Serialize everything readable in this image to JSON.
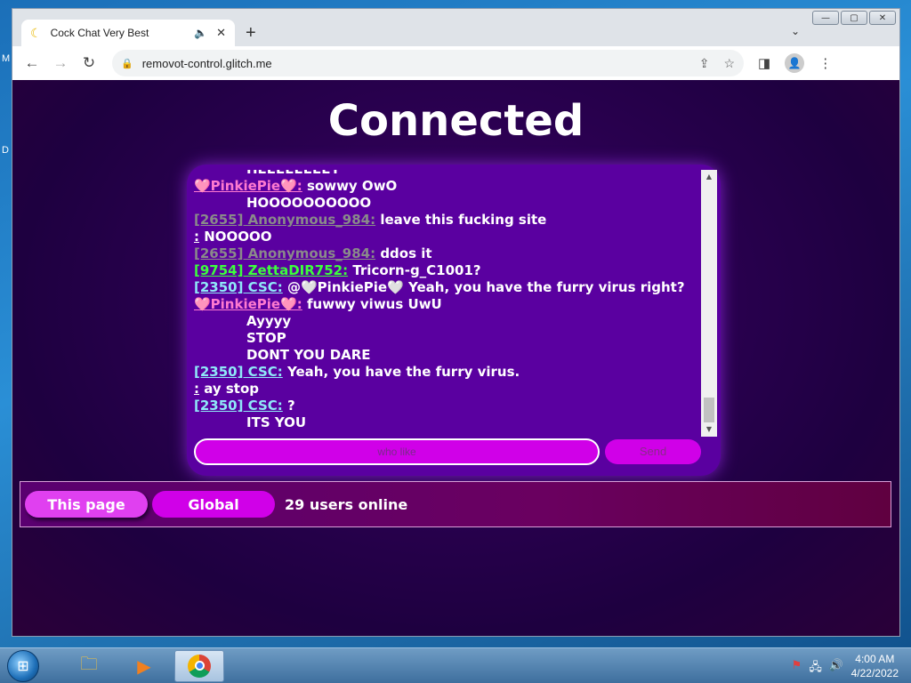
{
  "desktop": {
    "edge_glyph_1": "M",
    "edge_glyph_2": "D"
  },
  "window": {
    "minimize": "—",
    "maximize": "▢",
    "close": "✕"
  },
  "tab": {
    "title": "Cock Chat Very Best",
    "favicon": "☾",
    "mute_icon": "🔈",
    "close": "✕"
  },
  "newtab": "+",
  "tab_dropdown": "⌄",
  "toolbar": {
    "back": "←",
    "forward": "→",
    "reload": "↻",
    "lock": "🔒",
    "url": "removot-control.glitch.me",
    "share": "⇪",
    "star": "☆",
    "sidepanel": "◨",
    "profile": "👤",
    "menu": "⋮"
  },
  "page": {
    "title": "Connected",
    "messages": [
      {
        "indent": true,
        "cut": true,
        "user": "",
        "text": "HEEEEEEEEY"
      },
      {
        "user": "🩷PinkiePie🩷:",
        "color": "pink",
        "text": " sowwy OwO"
      },
      {
        "indent": true,
        "user": "",
        "text": "HOOOOOOOOOO"
      },
      {
        "user": "[2655] Anonymous_984:",
        "color": "gray",
        "text": " leave this fucking site"
      },
      {
        "user": ":",
        "color": "white",
        "text": " NOOOOO"
      },
      {
        "user": "[2655] Anonymous_984:",
        "color": "gray",
        "text": " ddos it"
      },
      {
        "user": "[9754] ZettaDIR752:",
        "color": "green",
        "text": " Tricorn-g_C1001?"
      },
      {
        "user": "[2350] CSC:",
        "color": "cyan",
        "text": " @🤍PinkiePie🤍 Yeah, you have the furry virus right?"
      },
      {
        "user": "🩷PinkiePie🩷:",
        "color": "pink",
        "text": " fuwwy viwus UwU"
      },
      {
        "indent": true,
        "user": "",
        "text": "Ayyyy"
      },
      {
        "indent": true,
        "user": "",
        "text": "STOP"
      },
      {
        "indent": true,
        "user": "",
        "text": "DONT YOU DARE"
      },
      {
        "user": "[2350] CSC:",
        "color": "cyan",
        "text": " Yeah, you have the furry virus."
      },
      {
        "user": ":",
        "color": "white",
        "text": " ay stop"
      },
      {
        "user": "[2350] CSC:",
        "color": "cyan",
        "text": " ?"
      },
      {
        "indent": true,
        "user": "",
        "text": "ITS YOU"
      }
    ],
    "scroll_up": "▲",
    "scroll_down": "▼",
    "chat_input_value": "who like",
    "send_label": "Send",
    "this_page_label": "This page",
    "global_label": "Global",
    "online_text": "29 users online"
  },
  "taskbar": {
    "start": "⊞",
    "apps": [
      {
        "name": "explorer",
        "icon": "🗀"
      },
      {
        "name": "media",
        "icon": "▶"
      }
    ],
    "tray": {
      "flag": "⚑",
      "network": "🖧",
      "volume": "🔊"
    },
    "time": "4:00 AM",
    "date": "4/22/2022"
  },
  "colors": {
    "page_bg": "#2a0050",
    "chat_panel": "#5a00a0",
    "accent_magenta": "#d000e8",
    "pink_user": "#ff7ad0",
    "gray_user": "#8a8a8a",
    "green_user": "#3cff3c",
    "cyan_user": "#8fe8f8"
  }
}
